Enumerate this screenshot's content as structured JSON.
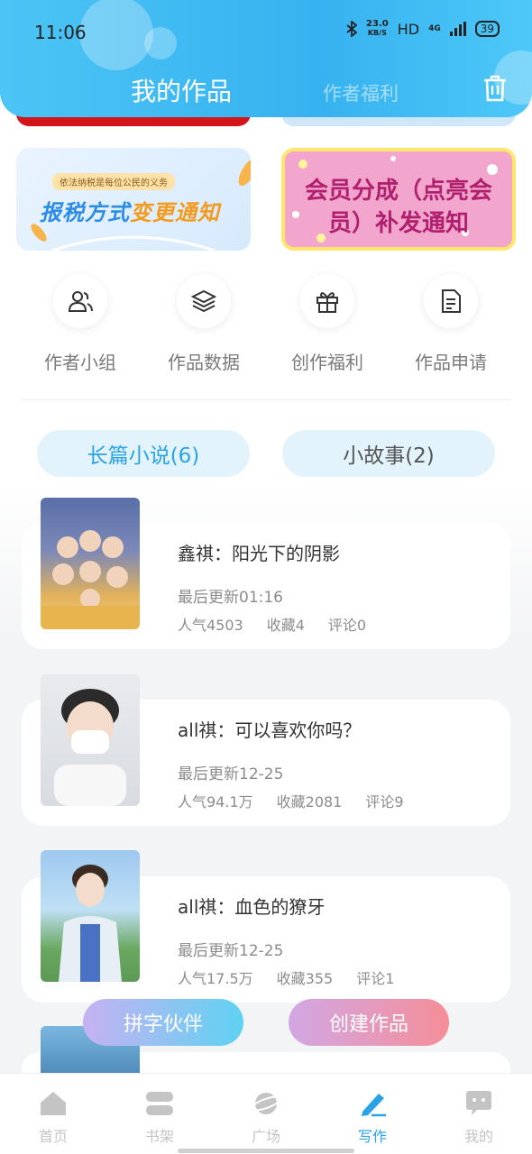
{
  "status_bar": {
    "time": "11:06",
    "speed_value": "23.0",
    "speed_unit": "KB/S",
    "hd": "HD",
    "network": "4G",
    "battery": "39"
  },
  "header": {
    "tab_active": "我的作品",
    "tab_inactive": "作者福利"
  },
  "banners": {
    "left_subtitle": "依法纳税是每位公民的义务",
    "left_title_blue": "报税方式",
    "left_title_orange": "变更通知",
    "right_title_line1": "会员分成（点亮会",
    "right_title_line2": "员）补发通知"
  },
  "quick_actions": [
    {
      "label": "作者小组",
      "icon": "group-icon"
    },
    {
      "label": "作品数据",
      "icon": "layers-icon"
    },
    {
      "label": "创作福利",
      "icon": "gift-icon"
    },
    {
      "label": "作品申请",
      "icon": "document-icon"
    }
  ],
  "tabs": {
    "long": "长篇小说(6)",
    "short": "小故事(2)"
  },
  "works": [
    {
      "title": "鑫祺：阳光下的阴影",
      "updated": "最后更新01:16",
      "popularity": "人气4503",
      "favorites": "收藏4",
      "comments": "评论0"
    },
    {
      "title": "all祺：可以喜欢你吗？",
      "updated": "最后更新12-25",
      "popularity": "人气94.1万",
      "favorites": "收藏2081",
      "comments": "评论9"
    },
    {
      "title": "all祺：血色的獠牙",
      "updated": "最后更新12-25",
      "popularity": "人气17.5万",
      "favorites": "收藏355",
      "comments": "评论1"
    }
  ],
  "fabs": {
    "partner": "拼字伙伴",
    "create": "创建作品"
  },
  "bottom_nav": [
    {
      "label": "首页",
      "icon": "home-icon"
    },
    {
      "label": "书架",
      "icon": "bookshelf-icon"
    },
    {
      "label": "广场",
      "icon": "planet-icon"
    },
    {
      "label": "写作",
      "icon": "pen-icon"
    },
    {
      "label": "我的",
      "icon": "chat-bubble-icon"
    }
  ],
  "colors": {
    "accent": "#2aa3e6",
    "header": "#36b2f0"
  }
}
